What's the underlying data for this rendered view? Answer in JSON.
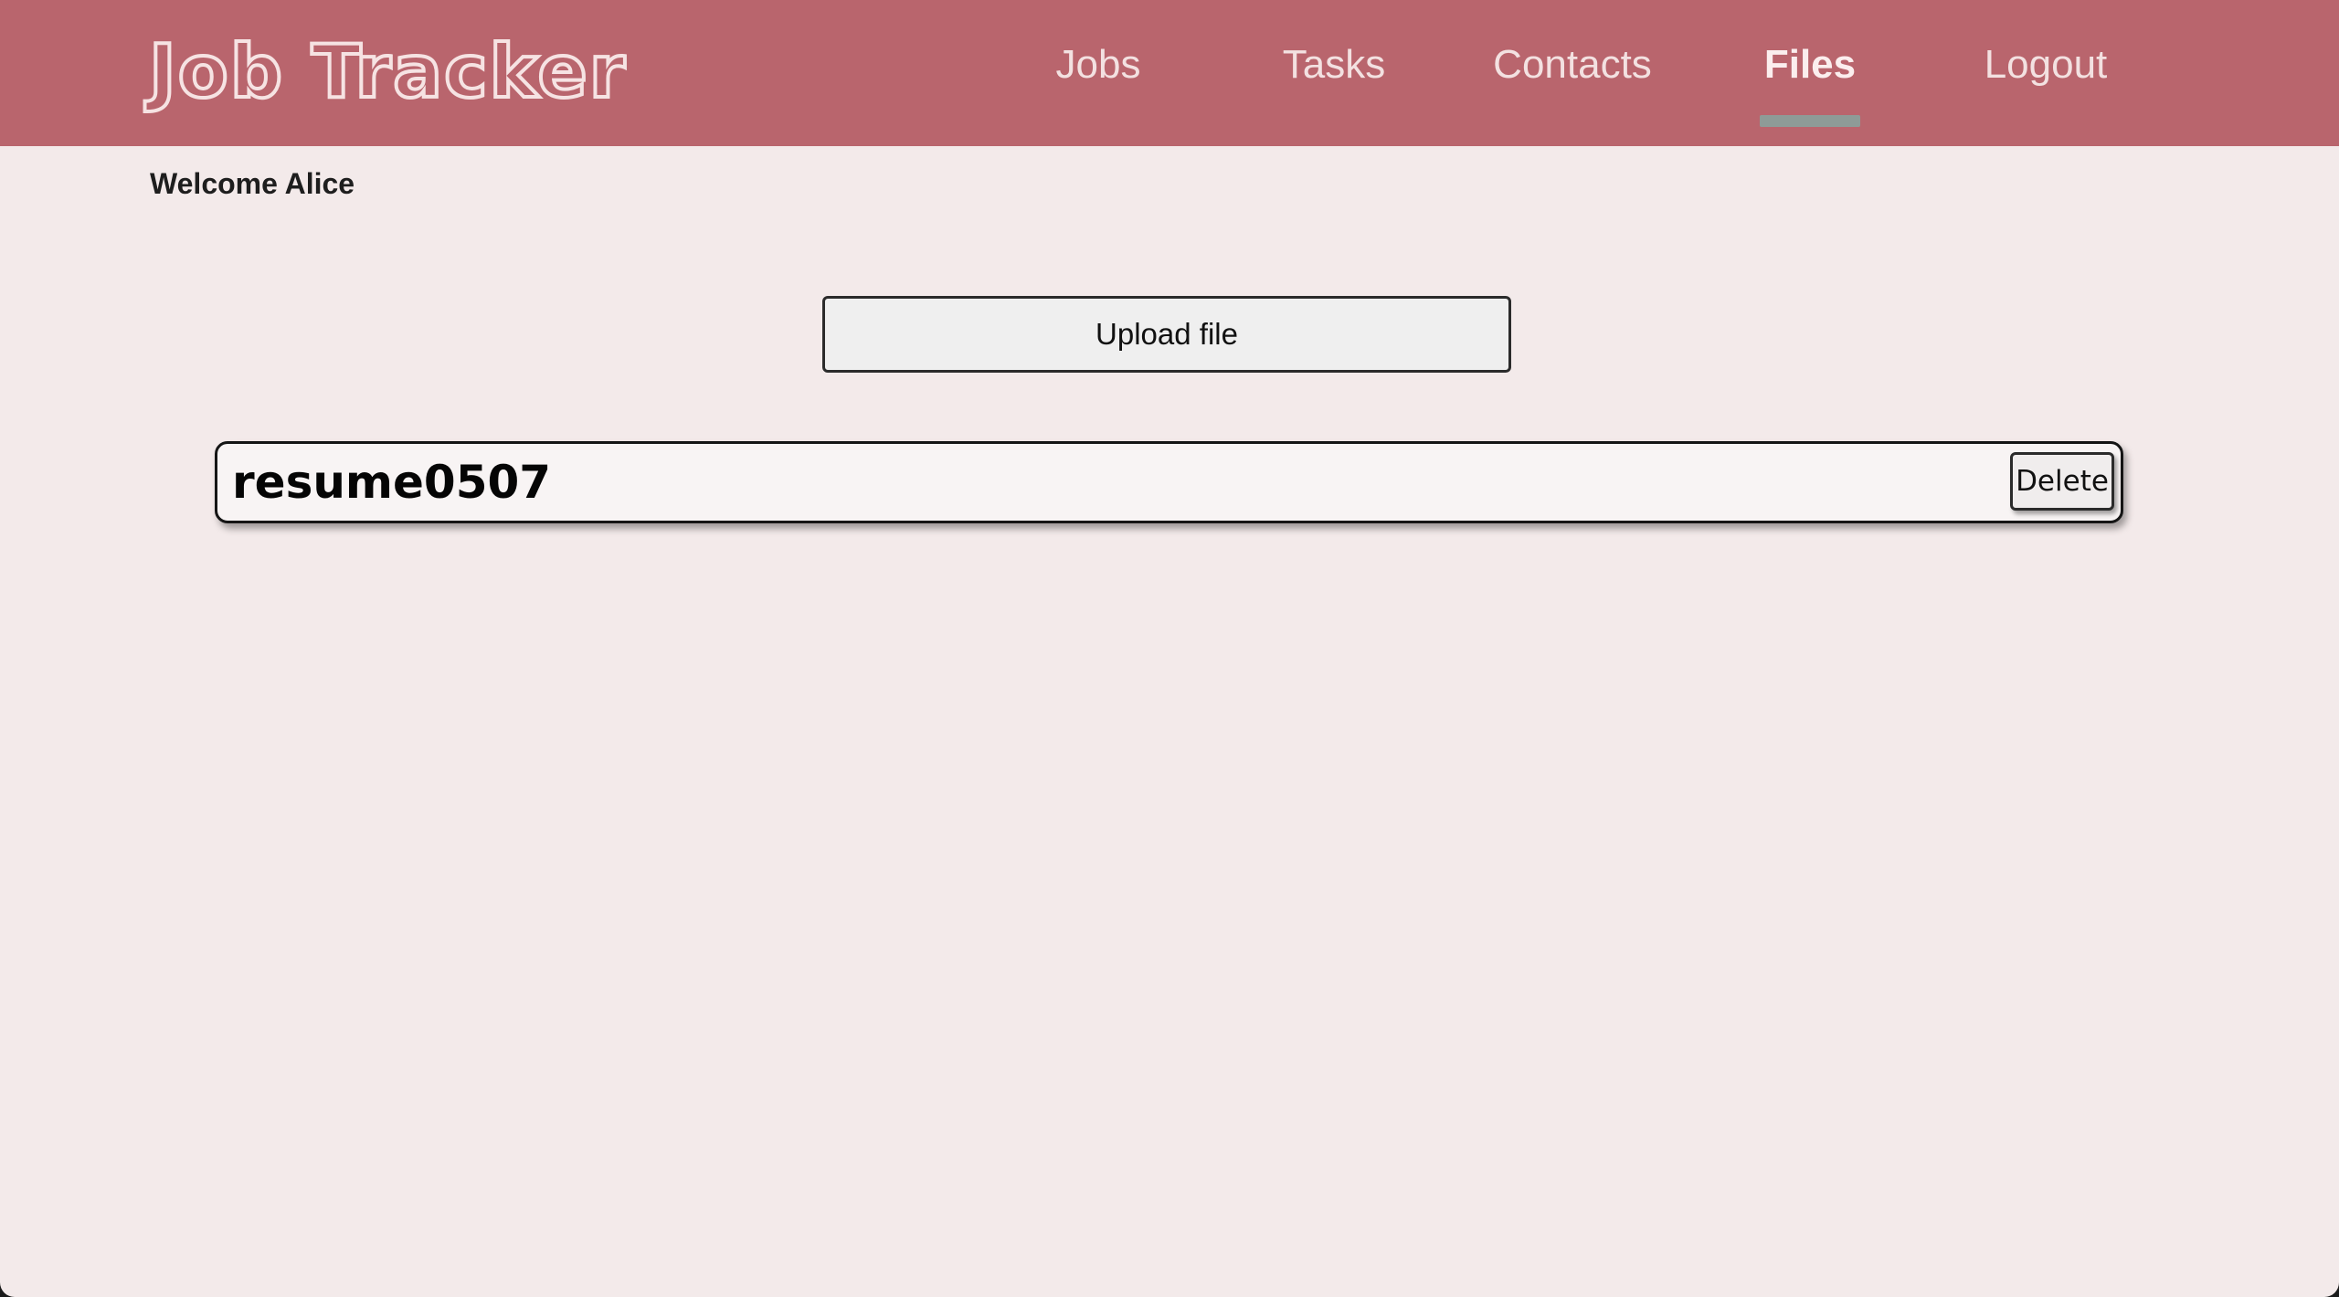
{
  "app": {
    "logo_text": "Job Tracker"
  },
  "nav": {
    "items": [
      {
        "label": "Jobs"
      },
      {
        "label": "Tasks"
      },
      {
        "label": "Contacts"
      },
      {
        "label": "Files",
        "active": true
      },
      {
        "label": "Logout"
      }
    ]
  },
  "welcome": {
    "text": "Welcome Alice"
  },
  "actions": {
    "upload_label": "Upload file"
  },
  "files": [
    {
      "name": "resume0507",
      "delete_label": "Delete"
    }
  ],
  "colors": {
    "navbar_bg": "#b9656d",
    "page_bg": "#f3eaea",
    "active_underline": "#8e9b97",
    "nav_text": "#f3e1e1"
  }
}
